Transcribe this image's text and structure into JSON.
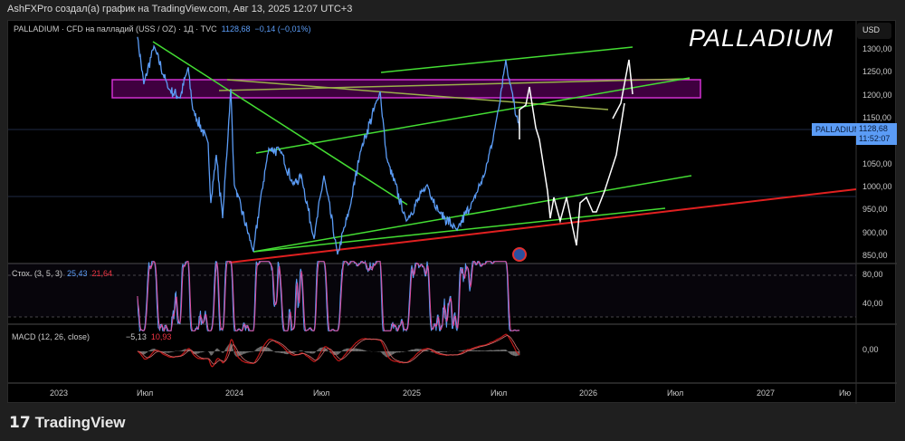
{
  "header": {
    "author_line": "AshFXPro создал(а) график на TradingView.com, Авг 13, 2025 12:07 UTC+3"
  },
  "symbol": {
    "legend": "PALLADIUM · CFD на палладий (USS / OZ) · 1Д · TVC",
    "price": "1128,68",
    "change": "−0,14 (−0,01%)",
    "overlay_title": "PALLADIUM",
    "currency": "USD",
    "badge_name": "PALLADIUM",
    "badge_price": "1128,68",
    "badge_timer": "11:52:07"
  },
  "price_axis": [
    "1300,00",
    "1250,00",
    "1200,00",
    "1150,00",
    "1050,00",
    "1000,00",
    "950,00",
    "900,00",
    "850,00"
  ],
  "stoch": {
    "label": "Стох. (3, 5, 3)",
    "k": "25,43",
    "d": "21,64",
    "axis": [
      "80,00",
      "40,00"
    ]
  },
  "macd": {
    "label": "MACD (12, 26, close)",
    "macd": "−5,13",
    "signal": "10,93",
    "axis": [
      "0,00"
    ]
  },
  "time_axis": [
    "2023",
    "Июл",
    "2024",
    "Июл",
    "2025",
    "Июл",
    "2026",
    "Июл",
    "2027",
    "Ию"
  ],
  "footer": {
    "logo": "TradingView"
  },
  "colors": {
    "price_line": "#5b9cf6",
    "zone": "#c020c0",
    "trend": "#44dd33",
    "support": "#e02020",
    "projection": "#ffffff"
  },
  "chart_data": {
    "type": "line",
    "series": [
      {
        "name": "PALLADIUM",
        "points": [
          [
            2023.445,
            1328
          ],
          [
            2023.481,
            1225
          ],
          [
            2023.538,
            1308
          ],
          [
            2023.62,
            1215
          ],
          [
            2023.686,
            1195
          ],
          [
            2023.732,
            1262
          ],
          [
            2023.758,
            1170
          ],
          [
            2023.845,
            1097
          ],
          [
            2023.86,
            966
          ],
          [
            2023.891,
            1071
          ],
          [
            2023.927,
            933
          ],
          [
            2023.973,
            1215
          ],
          [
            2023.993,
            1006
          ],
          [
            2024.101,
            860
          ],
          [
            2024.142,
            978
          ],
          [
            2024.188,
            1085
          ],
          [
            2024.26,
            1077
          ],
          [
            2024.326,
            1006
          ],
          [
            2024.372,
            1026
          ],
          [
            2024.444,
            888
          ],
          [
            2024.5,
            1026
          ],
          [
            2024.577,
            854
          ],
          [
            2024.649,
            959
          ],
          [
            2024.705,
            1077
          ],
          [
            2024.818,
            1209
          ],
          [
            2024.854,
            1065
          ],
          [
            2024.966,
            927
          ],
          [
            2025.084,
            1006
          ],
          [
            2025.15,
            947
          ],
          [
            2025.253,
            907
          ],
          [
            2025.345,
            972
          ],
          [
            2025.412,
            1032
          ],
          [
            2025.468,
            1130
          ],
          [
            2025.529,
            1278
          ],
          [
            2025.56,
            1215
          ],
          [
            2025.586,
            1156
          ],
          [
            2025.606,
            1128.68
          ]
        ]
      }
    ],
    "ylim": [
      830,
      1360
    ],
    "xlim": [
      2022.72,
      2027.5
    ],
    "resistance_zone": [
      1195,
      1235
    ]
  }
}
